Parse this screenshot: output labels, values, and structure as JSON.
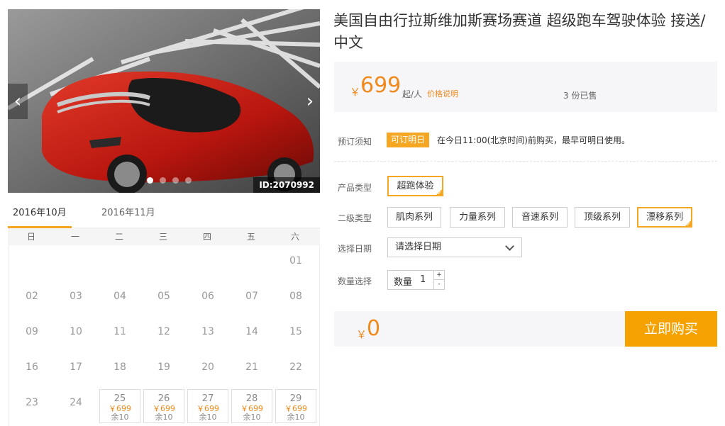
{
  "gallery": {
    "prev_icon": "chevron-left-icon",
    "next_icon": "chevron-right-icon",
    "prev_glyph": "‹",
    "next_glyph": "›",
    "slide_count": 4,
    "active_slide": 1,
    "photo_id": "ID:2070992"
  },
  "calendar": {
    "months": [
      {
        "label": "2016年10月",
        "active": true
      },
      {
        "label": "2016年11月",
        "active": false
      }
    ],
    "weekdays": [
      "日",
      "一",
      "二",
      "三",
      "四",
      "五",
      "六"
    ],
    "weeks": [
      [
        {
          "d": ""
        },
        {
          "d": ""
        },
        {
          "d": ""
        },
        {
          "d": ""
        },
        {
          "d": ""
        },
        {
          "d": ""
        },
        {
          "d": "01"
        }
      ],
      [
        {
          "d": "02"
        },
        {
          "d": "03"
        },
        {
          "d": "04"
        },
        {
          "d": "05"
        },
        {
          "d": "06"
        },
        {
          "d": "07"
        },
        {
          "d": "08"
        }
      ],
      [
        {
          "d": "09"
        },
        {
          "d": "10"
        },
        {
          "d": "11"
        },
        {
          "d": "12"
        },
        {
          "d": "13"
        },
        {
          "d": "14"
        },
        {
          "d": "15"
        }
      ],
      [
        {
          "d": "16"
        },
        {
          "d": "17"
        },
        {
          "d": "18"
        },
        {
          "d": "19"
        },
        {
          "d": "20"
        },
        {
          "d": "21"
        },
        {
          "d": "22"
        }
      ],
      [
        {
          "d": "23"
        },
        {
          "d": "24"
        },
        {
          "d": "25",
          "price": "￥699",
          "left": "余10"
        },
        {
          "d": "26",
          "price": "￥699",
          "left": "余10"
        },
        {
          "d": "27",
          "price": "￥699",
          "left": "余10"
        },
        {
          "d": "28",
          "price": "￥699",
          "left": "余10"
        },
        {
          "d": "29",
          "price": "￥699",
          "left": "余10"
        }
      ]
    ]
  },
  "product": {
    "title": "美国自由行拉斯维加斯赛场赛道 超级跑车驾驶体验 接送/中文",
    "price": {
      "currency": "￥",
      "amount": "699",
      "unit": "起/人",
      "explain_link": "价格说明",
      "sold": "3 份已售"
    }
  },
  "booking": {
    "notice_label": "预订须知",
    "notice_badge": "可订明日",
    "notice_text": "在今日11:00(北京时间)前购买，最早可明日使用。",
    "type_label": "产品类型",
    "types": [
      {
        "label": "超跑体验",
        "selected": true
      }
    ],
    "subtype_label": "二级类型",
    "subtypes": [
      {
        "label": "肌肉系列",
        "selected": false
      },
      {
        "label": "力量系列",
        "selected": false
      },
      {
        "label": "音速系列",
        "selected": false
      },
      {
        "label": "顶级系列",
        "selected": false
      },
      {
        "label": "漂移系列",
        "selected": true
      }
    ],
    "date_label": "选择日期",
    "date_placeholder": "请选择日期",
    "qty_label": "数量选择",
    "qty_inner_label": "数量",
    "qty_value": "1",
    "plus": "+",
    "minus": "-"
  },
  "checkout": {
    "currency": "￥",
    "total": "0",
    "buy_label": "立即购买"
  },
  "colors": {
    "accent": "#f5a623",
    "price": "#f08a1c",
    "buy_button": "#f5a100",
    "panel_bg": "#f6f5f8"
  }
}
